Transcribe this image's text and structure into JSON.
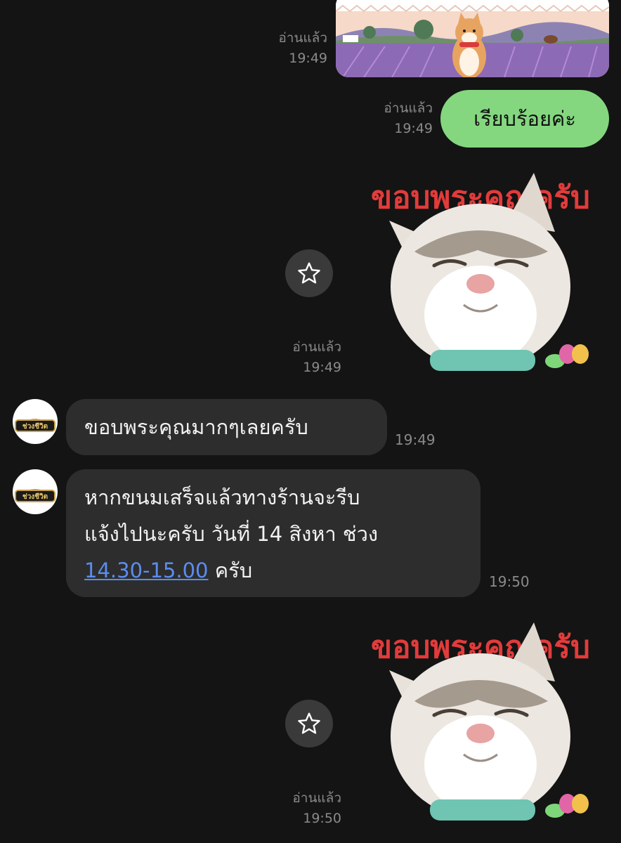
{
  "messages": {
    "image_msg": {
      "read": "อ่านแล้ว",
      "time": "19:49"
    },
    "text_out": {
      "text": "เรียบร้อยค่ะ",
      "read": "อ่านแล้ว",
      "time": "19:49"
    },
    "sticker_1": {
      "caption": "ขอบพระคุณครับ",
      "read": "อ่านแล้ว",
      "time": "19:49"
    },
    "text_in_1": {
      "text": "ขอบพระคุณมากๆเลยครับ",
      "time": "19:49"
    },
    "text_in_2": {
      "line1": "หากขนมเสร็จแล้วทางร้านจะรีบ",
      "line2": "แจ้งไปนะครับ วันที่ 14 สิงหา ช่วง",
      "link": "14.30-15.00",
      "suffix": " ครับ",
      "time": "19:50"
    },
    "sticker_2": {
      "caption": "ขอบพระคุณครับ",
      "read": "อ่านแล้ว",
      "time": "19:50"
    }
  },
  "avatar": {
    "logo_text": "ช่วงชีวิต"
  },
  "icons": {
    "star": "star-icon"
  },
  "colors": {
    "background": "#141414",
    "outgoing_bubble": "#84d77f",
    "incoming_bubble": "#2d2d2d",
    "link": "#5b8def",
    "meta_text": "#8a8a8a"
  }
}
